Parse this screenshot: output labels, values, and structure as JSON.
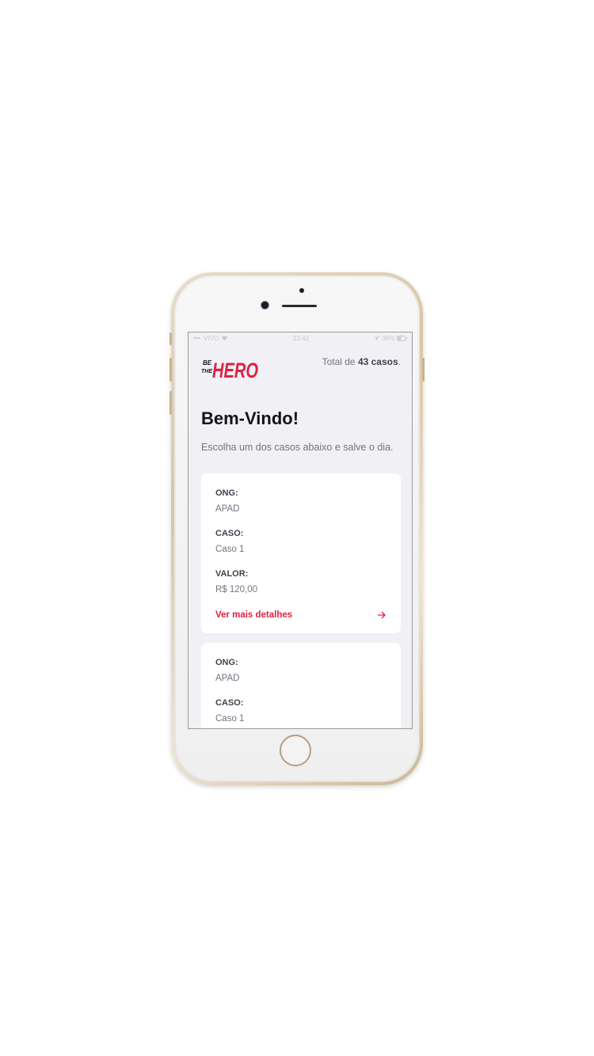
{
  "status_bar": {
    "carrier": "VIVO",
    "time": "23:42",
    "battery": "38%"
  },
  "header": {
    "logo_top": "BE",
    "logo_mid": "THE",
    "logo_word": "HERO",
    "total_prefix": "Total de",
    "total_count": "43 casos",
    "total_suffix": "."
  },
  "main": {
    "title": "Bem-Vindo!",
    "description": "Escolha um dos casos abaixo e salve o dia."
  },
  "incidents": [
    {
      "ong_label": "ONG:",
      "ong_value": "APAD",
      "case_label": "CASO:",
      "case_value": "Caso 1",
      "value_label": "VALOR:",
      "value_value": "R$ 120,00",
      "details_label": "Ver mais detalhes"
    },
    {
      "ong_label": "ONG:",
      "ong_value": "APAD",
      "case_label": "CASO:",
      "case_value": "Caso 1"
    }
  ],
  "colors": {
    "accent": "#e02041",
    "background": "#f0f0f5",
    "card": "#ffffff",
    "title": "#13131a",
    "text": "#737380",
    "label": "#41414d"
  },
  "icons": {
    "details": "arrow-right-icon",
    "signal": "signal-icon",
    "wifi": "wifi-icon",
    "battery": "battery-icon"
  }
}
